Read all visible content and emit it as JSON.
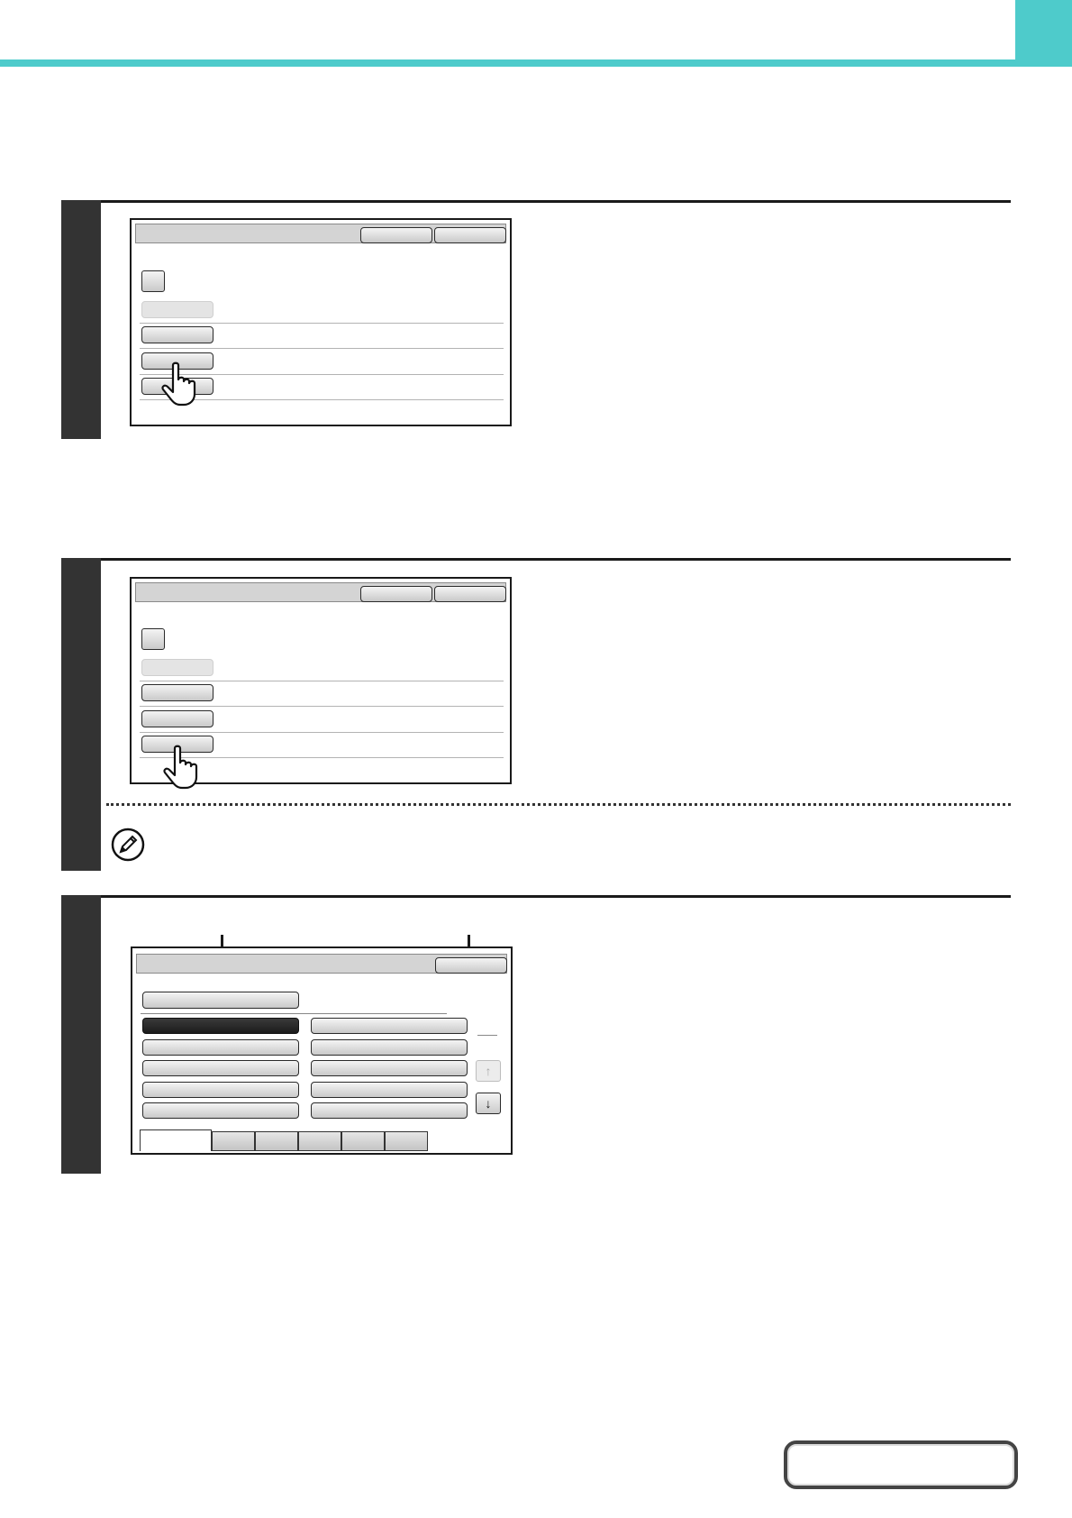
{
  "colors": {
    "accent": "#4ecbcb",
    "step_bar": "#333333",
    "panel_title": "#d4d4d4",
    "selected_button": "#222222"
  },
  "icons": {
    "pointer": "pointing-hand-icon",
    "note": "pencil-note-icon",
    "scroll_up": "arrow-up-icon",
    "scroll_down": "arrow-down-icon"
  },
  "glyphs": {
    "up": "↑",
    "down": "↓"
  }
}
